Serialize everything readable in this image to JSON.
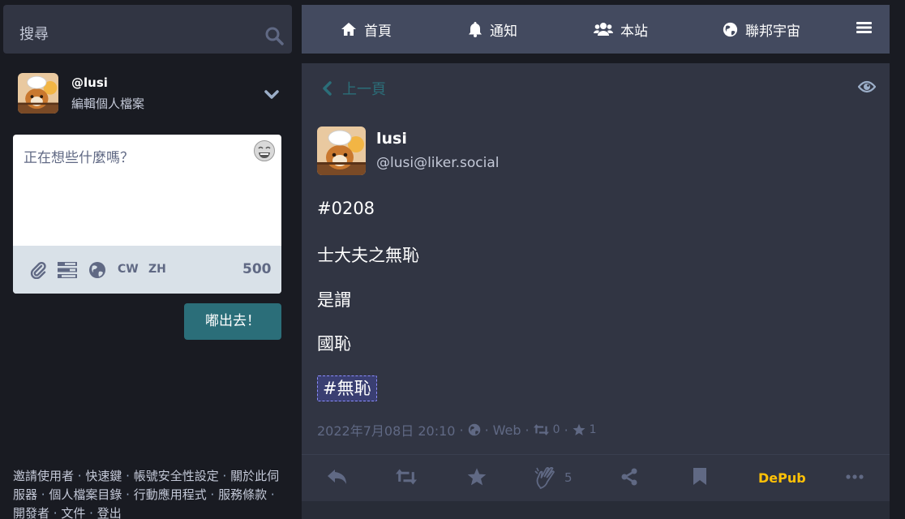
{
  "search": {
    "placeholder": "搜尋"
  },
  "me": {
    "handle": "@lusi",
    "edit_profile": "編輯個人檔案"
  },
  "compose": {
    "placeholder": "正在想些什麼嗎？",
    "cw_label": "CW",
    "lang_label": "ZH",
    "char_count": "500",
    "publish_label": "嘟出去！"
  },
  "footer": {
    "links": [
      "邀請使用者",
      "快速鍵",
      "帳號安全性設定",
      "關於此伺服器",
      "個人檔案目錄",
      "行動應用程式",
      "服務條款",
      "開發者",
      "文件",
      "登出"
    ],
    "separator": "·"
  },
  "nav": {
    "home": "首頁",
    "notifications": "通知",
    "local": "本站",
    "federated": "聯邦宇宙"
  },
  "column": {
    "back_label": "上一頁"
  },
  "status": {
    "display_name": "lusi",
    "account": "@lusi@liker.social",
    "paragraphs": [
      "#0208",
      "士大夫之無恥",
      "是謂",
      "國恥"
    ],
    "hashtag": "#無恥",
    "timestamp": "2022年7月08日 20:10",
    "dot": "·",
    "application": "Web",
    "reblogs": "0",
    "favourites": "1",
    "reactions_count": "5",
    "depub_label": "DePub"
  },
  "colors": {
    "background": "#191b22",
    "panel": "#313543",
    "nav": "#434a5f",
    "accent": "#2b6e79",
    "depub": "#ffc107",
    "muted": "#606984"
  },
  "icons": [
    "search-icon",
    "chevron-down-icon",
    "emoji-icon",
    "paperclip-icon",
    "poll-icon",
    "globe-icon",
    "home-icon",
    "bell-icon",
    "users-icon",
    "menu-icon",
    "chevron-left-icon",
    "eye-icon",
    "retweet-icon",
    "star-icon",
    "reply-icon",
    "hand-icon",
    "share-icon",
    "bookmark-icon",
    "ellipsis-icon"
  ]
}
